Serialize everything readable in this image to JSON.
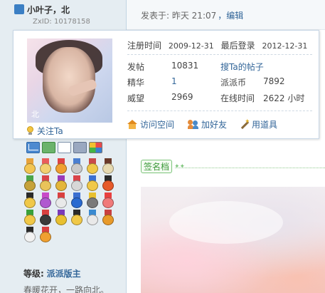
{
  "user": {
    "name": "小叶子，北",
    "zxid": "ZxID: 10178158"
  },
  "post": {
    "time_text": "发表于: 昨天  21:07",
    "edit_label": "，编辑"
  },
  "card": {
    "avatar_mark": "北",
    "follow_label": "关注Ta",
    "registered_label": "注册时间",
    "registered_value": "2009-12-31",
    "last_login_label": "最后登录",
    "last_login_value": "2012-12-31",
    "posts_label": "发帖",
    "posts_value": "10831",
    "their_posts_link": "搜Ta的帖子",
    "digest_label": "精华",
    "digest_value": "1",
    "coins_label": "派派币",
    "coins_value": "7892",
    "prestige_label": "威望",
    "prestige_value": "2969",
    "online_label": "在线时间",
    "online_value": "2622 小时",
    "actions": {
      "visit_space": "访问空间",
      "add_friend": "加好友",
      "use_item": "用道具"
    }
  },
  "sidebar": {
    "tools": [
      "mail-icon",
      "user-add-icon",
      "document-icon",
      "profile-icon",
      "blocks-icon"
    ],
    "medals": [
      {
        "rib": "#e8a23a",
        "disc": "#f3c552"
      },
      {
        "rib": "#e95c5c",
        "disc": "#f2d070"
      },
      {
        "rib": "#d44",
        "disc": "#f0a030"
      },
      {
        "rib": "#4a7fd0",
        "disc": "#c9c9c9"
      },
      {
        "rib": "#c94a4a",
        "disc": "#f0c848"
      },
      {
        "rib": "#6a3a2a",
        "disc": "#e6d9b0"
      },
      {
        "rib": "#4aa54a",
        "disc": "#c6a23a"
      },
      {
        "rib": "#d9444a",
        "disc": "#e9c35a"
      },
      {
        "rib": "#9a3ab8",
        "disc": "#e4b63a"
      },
      {
        "rib": "#d9444a",
        "disc": "#d7d7d7"
      },
      {
        "rib": "#3a6fd0",
        "disc": "#f0c848"
      },
      {
        "rib": "#2a2a2a",
        "disc": "#e65a2a"
      },
      {
        "rib": "#2a2a2a",
        "disc": "#f0c848"
      },
      {
        "rib": "#c84ac8",
        "disc": "#b05ad0"
      },
      {
        "rib": "#d94040",
        "disc": "#e9e9e9"
      },
      {
        "rib": "#3a6fd0",
        "disc": "#2a6ad0"
      },
      {
        "rib": "#e8c030",
        "disc": "#7a7a7a"
      },
      {
        "rib": "#e84040",
        "disc": "#f07a7a"
      },
      {
        "rib": "#3aa03a",
        "disc": "#f0c848"
      },
      {
        "rib": "#d94040",
        "disc": "#3a3a3a"
      },
      {
        "rib": "#7a3ab8",
        "disc": "#e8c030"
      },
      {
        "rib": "#2a2a2a",
        "disc": "#f0c848"
      },
      {
        "rib": "#3a8ad0",
        "disc": "#e9e9e9"
      },
      {
        "rib": "#c84040",
        "disc": "#e89a2a"
      },
      {
        "rib": "#2a2a2a",
        "disc": "#f2f2f2"
      },
      {
        "rib": "#d94040",
        "disc": "#f0a030"
      }
    ],
    "level_label": "等级:",
    "level_value": "派派版主",
    "motto": "春暖花开，一路向北。"
  },
  "signature": {
    "badge_label": "签名档"
  }
}
